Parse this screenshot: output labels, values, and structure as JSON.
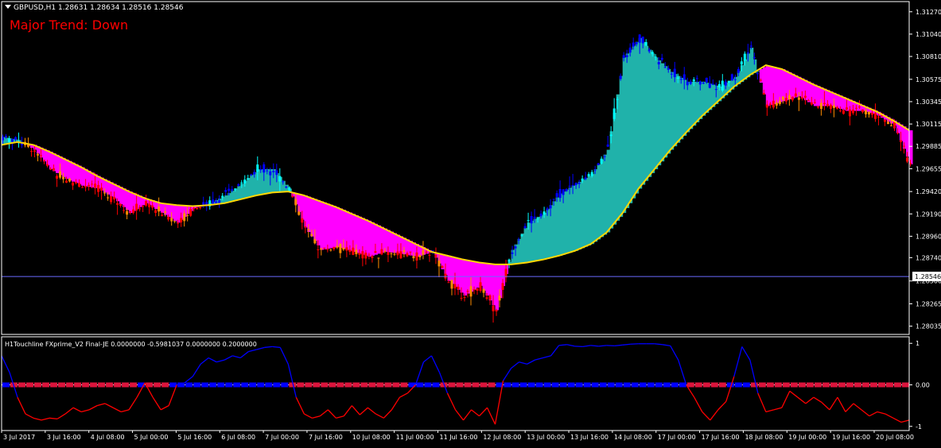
{
  "header": {
    "symbol_line": "GBPUSD,H1  1.28631 1.28634 1.28516 1.28546",
    "trend_text": "Major Trend: Down"
  },
  "colors": {
    "background": "#000000",
    "frame": "#ffffff",
    "bull_candle": "#0000ff",
    "bear_candle": "#ff0000",
    "bull_cloud": "#20b2aa",
    "bear_cloud": "#ff00ff",
    "bull_cloud_edge": "#00ffff",
    "bear_cloud_edge": "#ff8c00",
    "ma_line": "#ffd700",
    "price_line": "#6a6aff",
    "indicator_up": "#0000ff",
    "indicator_down": "#ff0000",
    "hist_up": "#0000ff",
    "hist_down": "#dc143c",
    "zero_line": "#ffffff"
  },
  "chart_data": [
    {
      "type": "line",
      "title": "GBPUSD,H1",
      "ohlc_last": {
        "open": 1.28631,
        "high": 1.28634,
        "low": 1.28516,
        "close": 1.28546
      },
      "current_price_label": "1.28546",
      "ylim": [
        1.2795,
        1.3135
      ],
      "yticks": [
        "1.31270",
        "1.31040",
        "1.30810",
        "1.30575",
        "1.30345",
        "1.30115",
        "1.29885",
        "1.29655",
        "1.29420",
        "1.29190",
        "1.28960",
        "1.28740",
        "1.28500",
        "1.28265",
        "1.28035"
      ],
      "x": [
        0,
        20,
        40,
        60,
        80,
        100,
        120,
        140,
        160,
        180,
        200,
        220,
        240,
        260,
        280,
        300,
        320,
        340,
        360,
        380,
        400,
        420,
        440,
        460,
        480,
        500,
        520,
        540,
        560,
        580,
        600,
        620,
        640,
        660,
        680,
        700,
        720,
        740,
        760,
        780,
        800,
        820,
        840,
        860,
        880,
        900,
        920,
        940,
        960,
        980,
        1000,
        1020,
        1040,
        1060,
        1080,
        1100,
        1120,
        1140
      ],
      "series": [
        {
          "name": "",
          "values": [
            1.2998,
            1.2995,
            1.2985,
            1.2965,
            1.2955,
            1.2948,
            1.2945,
            1.2935,
            1.292,
            1.293,
            1.292,
            1.291,
            1.2925,
            1.293,
            1.2938,
            1.295,
            1.2965,
            1.2965,
            1.2945,
            1.2905,
            1.2882,
            1.2885,
            1.288,
            1.2875,
            1.288,
            1.2878,
            1.2875,
            1.288,
            1.285,
            1.2835,
            1.2845,
            1.282,
            1.2882,
            1.291,
            1.292,
            1.294,
            1.295,
            1.296,
            1.2985,
            1.308,
            1.31,
            1.308,
            1.3065,
            1.3055,
            1.3055,
            1.305,
            1.306,
            1.309,
            1.303,
            1.3035,
            1.304,
            1.303,
            1.303,
            1.3025,
            1.3025,
            1.302,
            1.301,
            1.297
          ]
        },
        {
          "name": "",
          "values": [
            1.299,
            1.2993,
            1.299,
            1.2983,
            1.2975,
            1.2967,
            1.2958,
            1.295,
            1.2942,
            1.2935,
            1.293,
            1.2928,
            1.2927,
            1.2928,
            1.293,
            1.2934,
            1.2938,
            1.2941,
            1.2942,
            1.2938,
            1.2932,
            1.2926,
            1.2919,
            1.2912,
            1.2904,
            1.2896,
            1.2888,
            1.288,
            1.2876,
            1.2872,
            1.2869,
            1.2867,
            1.2867,
            1.2869,
            1.2872,
            1.2876,
            1.2881,
            1.2888,
            1.29,
            1.292,
            1.2945,
            1.2965,
            1.2985,
            1.3003,
            1.302,
            1.3035,
            1.305,
            1.3062,
            1.3072,
            1.3068,
            1.306,
            1.3052,
            1.3045,
            1.3038,
            1.3031,
            1.3024,
            1.3015,
            1.3005
          ]
        }
      ]
    },
    {
      "type": "line",
      "title": "H1Touchline  FXprime_V2 Final-JE 0.0000000 -0.5981037 0.0000000 0.2000000",
      "ylim": [
        -1.1,
        1.1
      ],
      "yticks": [
        "1",
        "0.00",
        "-1"
      ],
      "xticks": [
        "3 Jul 2017",
        "3 Jul 16:00",
        "4 Jul 08:00",
        "5 Jul 00:00",
        "5 Jul 16:00",
        "6 Jul 08:00",
        "7 Jul 00:00",
        "7 Jul 16:00",
        "10 Jul 08:00",
        "11 Jul 00:00",
        "11 Jul 16:00",
        "12 Jul 08:00",
        "13 Jul 00:00",
        "13 Jul 16:00",
        "14 Jul 08:00",
        "17 Jul 00:00",
        "17 Jul 16:00",
        "18 Jul 08:00",
        "19 Jul 00:00",
        "19 Jul 16:00",
        "20 Jul 08:00"
      ],
      "x": [
        0,
        10,
        20,
        30,
        40,
        50,
        60,
        70,
        80,
        90,
        100,
        110,
        120,
        130,
        140,
        150,
        160,
        170,
        180,
        190,
        200,
        210,
        220,
        230,
        240,
        250,
        260,
        270,
        280,
        290,
        300,
        310,
        320,
        330,
        340,
        350,
        360,
        370,
        380,
        390,
        400,
        410,
        420,
        430,
        440,
        450,
        460,
        470,
        480,
        490,
        500,
        510,
        520,
        530,
        540,
        550,
        560,
        570,
        580,
        590,
        600,
        610,
        620,
        630,
        640,
        650,
        660,
        670,
        680,
        690,
        700,
        710,
        720,
        730,
        740,
        750,
        760,
        770,
        780,
        790,
        800,
        810,
        820,
        830,
        840,
        850,
        860,
        870,
        880,
        890,
        900,
        910,
        920,
        930,
        940,
        950,
        960,
        970,
        980,
        990,
        1000,
        1010,
        1020,
        1030,
        1040,
        1050,
        1060,
        1070,
        1080,
        1090,
        1100,
        1110,
        1120,
        1130,
        1140
      ],
      "series": [
        {
          "name": "",
          "values": [
            0.7,
            0.3,
            -0.3,
            -0.7,
            -0.8,
            -0.85,
            -0.8,
            -0.82,
            -0.7,
            -0.55,
            -0.65,
            -0.6,
            -0.5,
            -0.45,
            -0.55,
            -0.65,
            -0.6,
            -0.3,
            0.05,
            -0.3,
            -0.6,
            -0.5,
            0.0,
            0.05,
            0.2,
            0.5,
            0.65,
            0.55,
            0.6,
            0.7,
            0.65,
            0.8,
            0.85,
            0.9,
            0.92,
            0.9,
            0.5,
            -0.3,
            -0.7,
            -0.8,
            -0.75,
            -0.6,
            -0.8,
            -0.75,
            -0.5,
            -0.72,
            -0.55,
            -0.7,
            -0.8,
            -0.6,
            -0.3,
            -0.2,
            0.0,
            0.55,
            0.7,
            0.3,
            -0.2,
            -0.6,
            -0.85,
            -0.6,
            -0.75,
            -0.55,
            -0.95,
            0.1,
            0.4,
            0.55,
            0.5,
            0.6,
            0.65,
            0.7,
            0.95,
            0.97,
            0.93,
            0.92,
            0.95,
            0.93,
            0.95,
            0.94,
            0.96,
            0.98,
            0.99,
            0.99,
            0.99,
            0.97,
            0.94,
            0.6,
            0.0,
            -0.3,
            -0.65,
            -0.85,
            -0.6,
            -0.4,
            0.2,
            0.92,
            0.6,
            -0.2,
            -0.65,
            -0.6,
            -0.55,
            -0.15,
            -0.3,
            -0.45,
            -0.3,
            -0.42,
            -0.6,
            -0.3,
            -0.65,
            -0.45,
            -0.6,
            -0.75,
            -0.65,
            -0.7,
            -0.8,
            -0.9,
            -0.85
          ]
        }
      ]
    }
  ]
}
